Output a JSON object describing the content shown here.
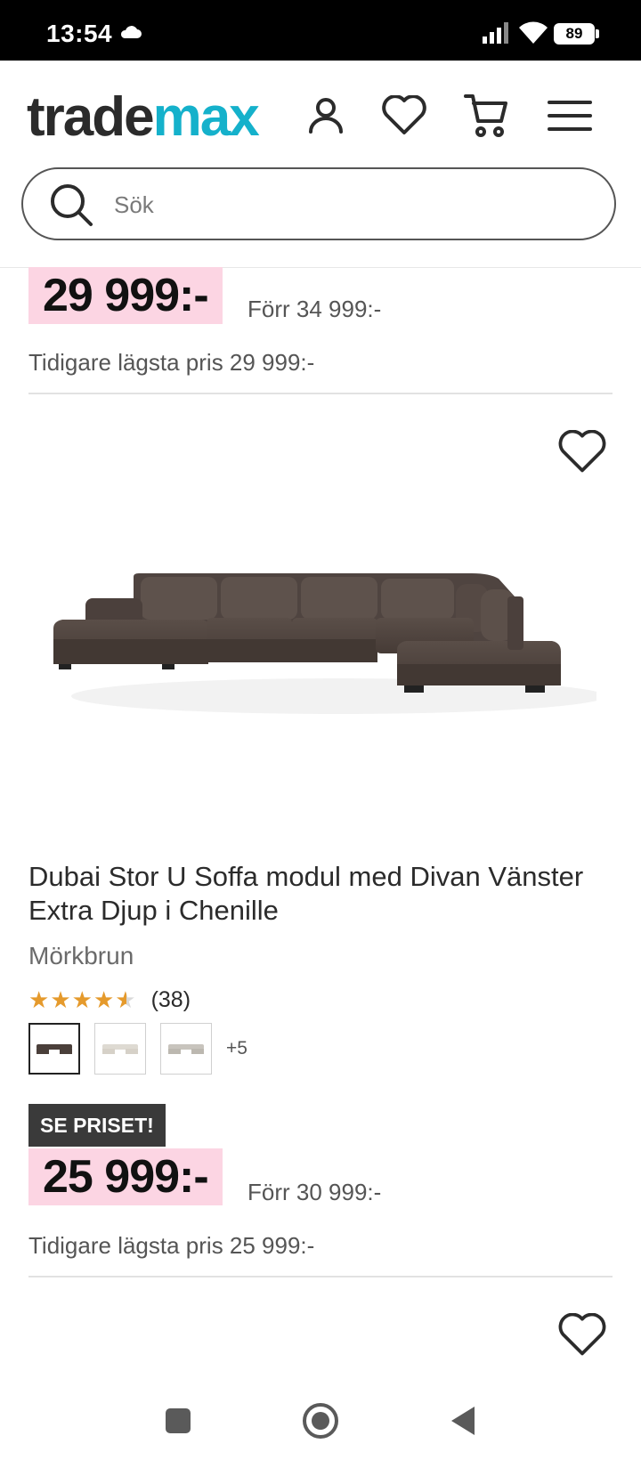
{
  "status_bar": {
    "time": "13:54",
    "battery": "89"
  },
  "header": {
    "logo_part1": "trade",
    "logo_part2": "max",
    "search_placeholder": "Sök"
  },
  "previous_product": {
    "price": "29 999:-",
    "previous_price": "Förr 34 999:-",
    "lowest_price": "Tidigare lägsta pris 29 999:-"
  },
  "product": {
    "title": "Dubai Stor U Soffa modul med Divan Vänster Extra Djup i Chenille",
    "color": "Mörkbrun",
    "rating": 4.5,
    "review_count": "(38)",
    "more_variants": "+5",
    "badge": "SE PRISET!",
    "price": "25 999:-",
    "previous_price": "Förr 30 999:-",
    "lowest_price": "Tidigare lägsta pris 25 999:-"
  },
  "colors": {
    "brand_teal": "#15b1cb",
    "price_bg": "#fcd5e3",
    "star": "#e59a2c",
    "badge_bg": "#3a3a3a"
  }
}
